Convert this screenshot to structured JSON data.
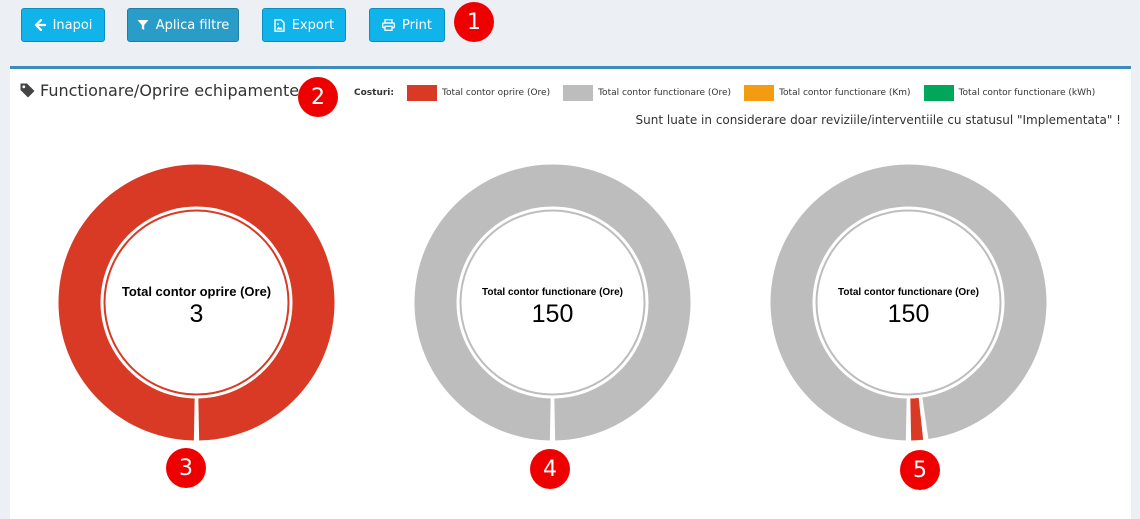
{
  "toolbar": {
    "back_label": "Inapoi",
    "filter_label": "Aplica filtre",
    "export_label": "Export",
    "print_label": "Print"
  },
  "badges": [
    "1",
    "2",
    "3",
    "4",
    "5"
  ],
  "panel": {
    "title": "Functionare/Oprire echipamente",
    "legend_title": "Costuri:",
    "legend": [
      {
        "label": "Total contor oprire (Ore)",
        "color": "#d93a25"
      },
      {
        "label": "Total contor functionare (Ore)",
        "color": "#bdbdbd"
      },
      {
        "label": "Total contor functionare (Km)",
        "color": "#f39c12"
      },
      {
        "label": "Total contor functionare (kWh)",
        "color": "#00a65a"
      }
    ],
    "note": "Sunt luate in considerare doar reviziile/interventiile cu statusul \"Implementata\" !"
  },
  "colors": {
    "accent": "#3c8dbc",
    "button": "#11b4ea",
    "badge": "#ee0000"
  },
  "charts": [
    {
      "label": "Total contor oprire (Ore)",
      "value": "3",
      "segments": [
        {
          "fraction": 1.0,
          "color": "#d93a25"
        }
      ]
    },
    {
      "label": "Total contor functionare (Ore)",
      "value": "150",
      "segments": [
        {
          "fraction": 1.0,
          "color": "#bdbdbd"
        }
      ]
    },
    {
      "label": "Total contor functionare (Ore)",
      "value": "150",
      "segments": [
        {
          "fraction": 0.98,
          "color": "#bdbdbd"
        },
        {
          "fraction": 0.02,
          "color": "#d93a25"
        }
      ]
    }
  ]
}
